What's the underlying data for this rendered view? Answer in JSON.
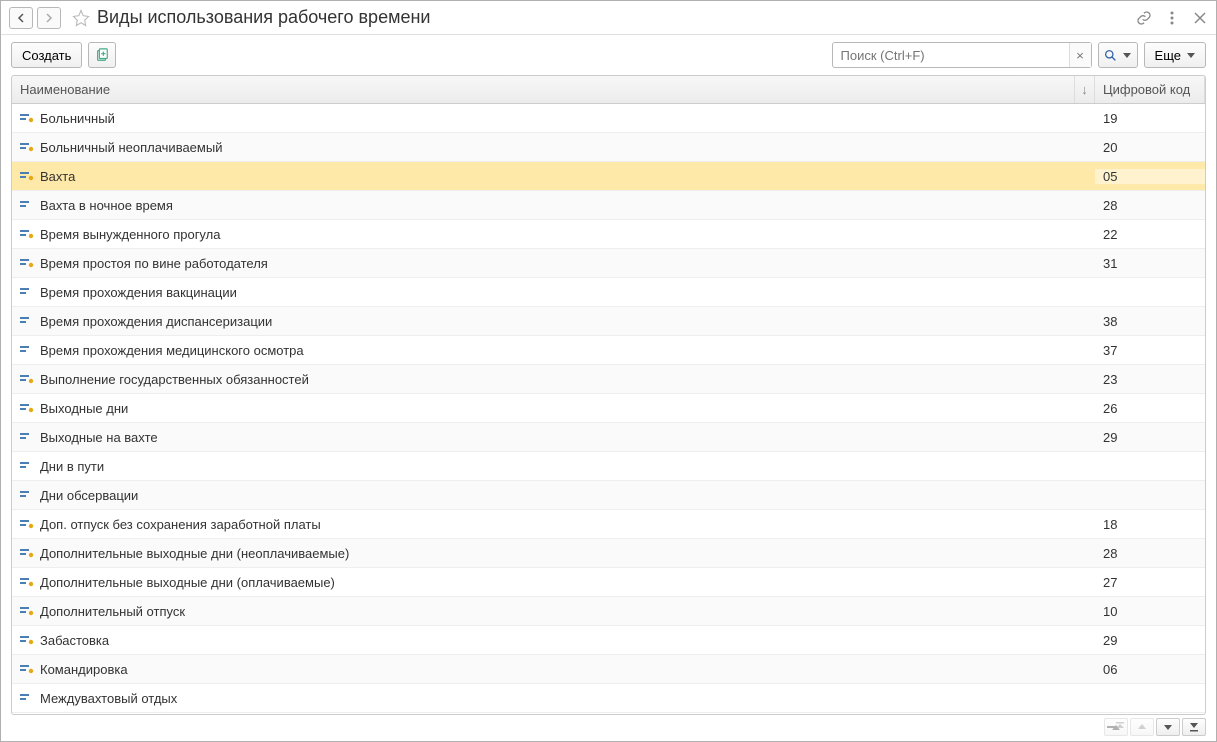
{
  "title": "Виды использования рабочего времени",
  "toolbar": {
    "create_label": "Создать",
    "more_label": "Еще"
  },
  "search": {
    "placeholder": "Поиск (Ctrl+F)"
  },
  "columns": {
    "name": "Наименование",
    "code": "Цифровой код",
    "sort_indicator": "↓"
  },
  "rows": [
    {
      "name": "Больничный",
      "code": "19",
      "locked": true,
      "selected": false
    },
    {
      "name": "Больничный неоплачиваемый",
      "code": "20",
      "locked": true,
      "selected": false
    },
    {
      "name": "Вахта",
      "code": "05",
      "locked": true,
      "selected": true
    },
    {
      "name": "Вахта в ночное время",
      "code": "28",
      "locked": false,
      "selected": false
    },
    {
      "name": "Время вынужденного прогула",
      "code": "22",
      "locked": true,
      "selected": false
    },
    {
      "name": "Время простоя по вине работодателя",
      "code": "31",
      "locked": true,
      "selected": false
    },
    {
      "name": "Время прохождения вакцинации",
      "code": "",
      "locked": false,
      "selected": false
    },
    {
      "name": "Время прохождения диспансеризации",
      "code": "38",
      "locked": false,
      "selected": false
    },
    {
      "name": "Время прохождения медицинского осмотра",
      "code": "37",
      "locked": false,
      "selected": false
    },
    {
      "name": "Выполнение государственных обязанностей",
      "code": "23",
      "locked": true,
      "selected": false
    },
    {
      "name": "Выходные дни",
      "code": "26",
      "locked": true,
      "selected": false
    },
    {
      "name": "Выходные на вахте",
      "code": "29",
      "locked": false,
      "selected": false
    },
    {
      "name": "Дни в пути",
      "code": "",
      "locked": false,
      "selected": false
    },
    {
      "name": "Дни обсервации",
      "code": "",
      "locked": false,
      "selected": false
    },
    {
      "name": "Доп. отпуск без сохранения заработной платы",
      "code": "18",
      "locked": true,
      "selected": false
    },
    {
      "name": "Дополнительные выходные дни (неоплачиваемые)",
      "code": "28",
      "locked": true,
      "selected": false
    },
    {
      "name": "Дополнительные выходные дни (оплачиваемые)",
      "code": "27",
      "locked": true,
      "selected": false
    },
    {
      "name": "Дополнительный отпуск",
      "code": "10",
      "locked": true,
      "selected": false
    },
    {
      "name": "Забастовка",
      "code": "29",
      "locked": true,
      "selected": false
    },
    {
      "name": "Командировка",
      "code": "06",
      "locked": true,
      "selected": false
    },
    {
      "name": "Междувахтовый отдых",
      "code": "",
      "locked": false,
      "selected": false
    }
  ]
}
